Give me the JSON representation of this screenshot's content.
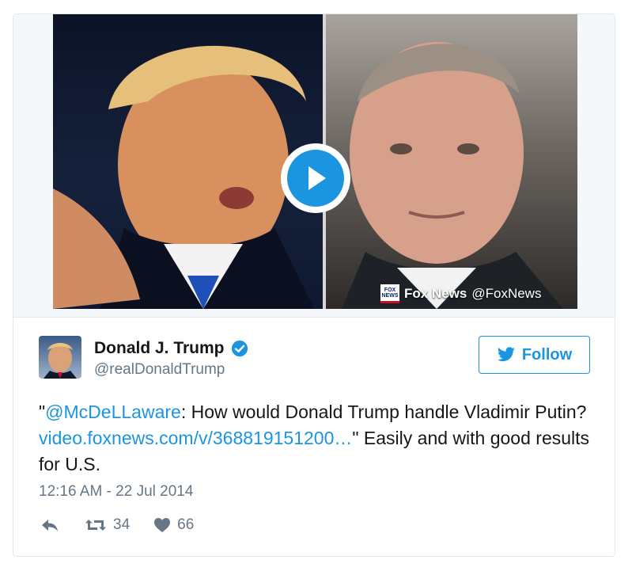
{
  "media": {
    "watermark_logo_text": "FOX NEWS",
    "watermark_brand": "Fox News",
    "watermark_handle": "@FoxNews"
  },
  "tweet": {
    "display_name": "Donald J. Trump",
    "screen_name": "@realDonaldTrump",
    "follow_label": "Follow",
    "text_quote_open": "\"",
    "mention": "@McDeLLaware",
    "text_part1": ": How would Donald Trump handle Vladimir Putin? ",
    "link": "video.foxnews.com/v/368819151200…",
    "text_part2": "\" Easily and with good results for U.S.",
    "timestamp": "12:16 AM - 22 Jul 2014",
    "retweet_count": "34",
    "like_count": "66"
  },
  "colors": {
    "accent": "#1b95e0",
    "secondary_text": "#657786",
    "primary_text": "#14171a",
    "border": "#e1e8ed"
  },
  "icons": [
    "play-icon",
    "verified-icon",
    "twitter-bird-icon",
    "reply-icon",
    "retweet-icon",
    "heart-icon"
  ]
}
